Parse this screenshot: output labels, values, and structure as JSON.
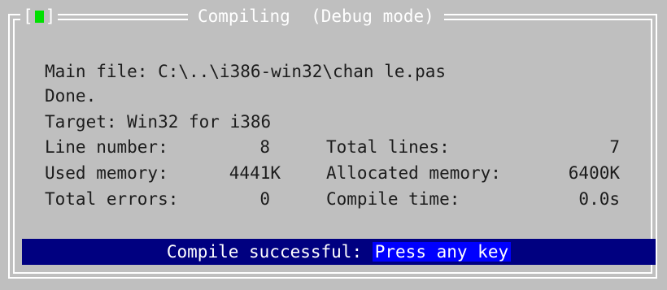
{
  "dialog": {
    "close_box": {
      "left_bracket": "[",
      "right_bracket": "]",
      "icon": "close-box-icon",
      "color": "#00e000"
    },
    "title": "Compiling  (Debug mode)"
  },
  "info": {
    "main_file": "Main file: C:\\..\\i386-win32\\chan le.pas",
    "status": "Done.",
    "target": "Target: Win32 for i386"
  },
  "stats": {
    "line_number_label": "Line number:",
    "line_number_value": "8",
    "total_lines_label": "Total lines:",
    "total_lines_value": "7",
    "used_memory_label": "Used memory:",
    "used_memory_value": "4441K",
    "allocated_memory_label": "Allocated memory:",
    "allocated_memory_value": "6400K",
    "total_errors_label": "Total errors:",
    "total_errors_value": "0",
    "compile_time_label": "Compile time:",
    "compile_time_value": "0.0s"
  },
  "status_bar": {
    "message": "Compile successful: ",
    "action": "Press any key"
  },
  "colors": {
    "background": "#bfbfbf",
    "status_bar": "#000080",
    "highlight": "#0000ff"
  }
}
